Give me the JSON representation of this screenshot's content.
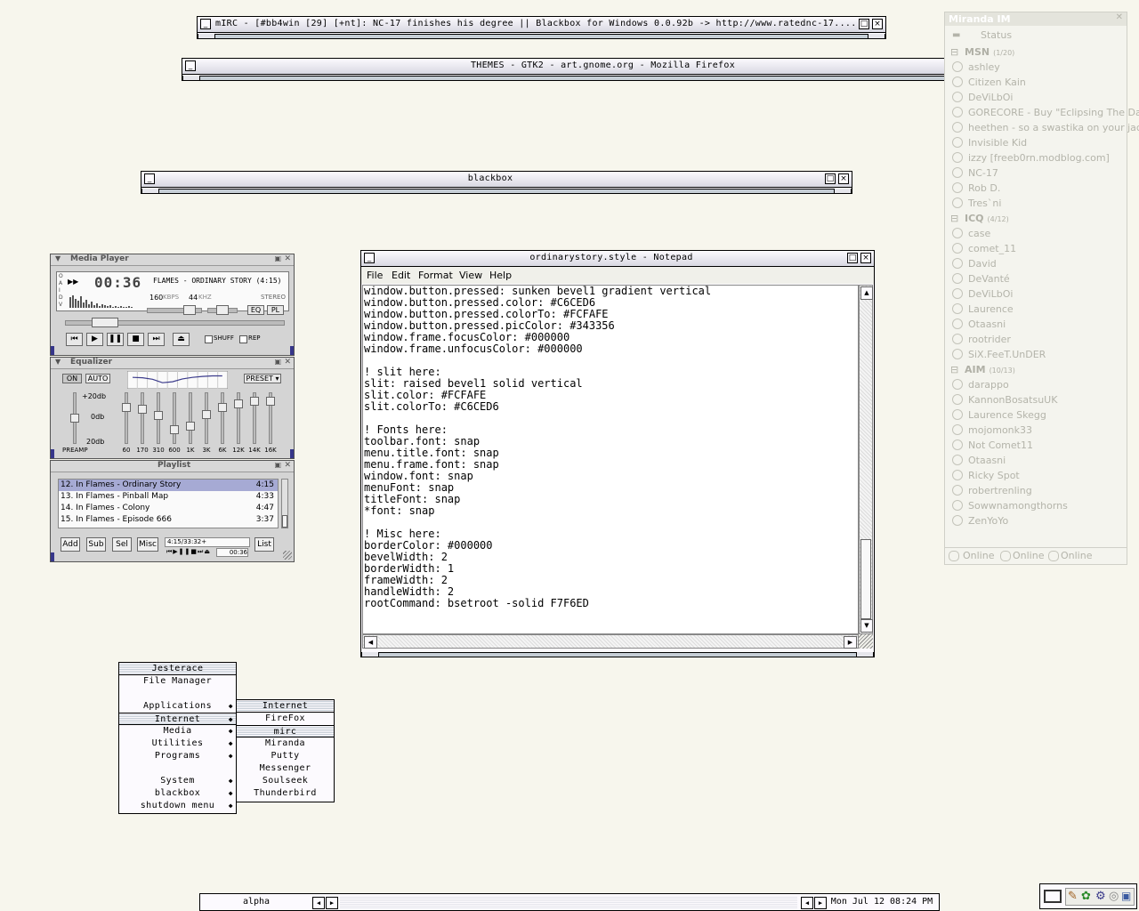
{
  "windows": {
    "mirc": {
      "title": "mIRC - [#bb4win [29] [+nt]: NC-17 finishes his degree || Blackbox for Windows 0.0.92b -> http://www.ratednc-17...."
    },
    "firefox": {
      "title": "THEMES - GTK2 - art.gnome.org - Mozilla Firefox"
    },
    "blackbox": {
      "title": "blackbox"
    }
  },
  "notepad": {
    "title": "ordinarystory.style - Notepad",
    "menu": [
      "File",
      "Edit",
      "Format",
      "View",
      "Help"
    ],
    "lines": [
      "window.button.pressed: sunken bevel1 gradient vertical",
      "window.button.pressed.color: #C6CED6",
      "window.button.pressed.colorTo: #FCFAFE",
      "window.button.pressed.picColor: #343356",
      "window.frame.focusColor: #000000",
      "window.frame.unfocusColor: #000000",
      "",
      "! slit here:",
      "slit: raised bevel1 solid vertical",
      "slit.color: #FCFAFE",
      "slit.colorTo: #C6CED6",
      "",
      "! Fonts here:",
      "toolbar.font: snap",
      "menu.title.font: snap",
      "menu.frame.font: snap",
      "window.font: snap",
      "menuFont: snap",
      "titleFont: snap",
      "*font: snap",
      "",
      "! Misc here:",
      "borderColor: #000000",
      "bevelWidth: 2",
      "borderWidth: 1",
      "frameWidth: 2",
      "handleWidth: 2",
      "rootCommand: bsetroot -solid F7F6ED"
    ]
  },
  "mediaplayer": {
    "title": "Media Player",
    "time": "00:36",
    "track": "FLAMES - ORDINARY STORY (4:15)",
    "kbps": "160",
    "kbps_unit": "KBPS",
    "khz": "44",
    "khz_unit": "KHZ",
    "stereo": "STEREO",
    "eq_btn": "EQ",
    "pl_btn": "PL",
    "shuff": "SHUFF",
    "rep": "REP",
    "seek_fraction": 0.14,
    "volume_fraction": 0.85,
    "balance_fraction": 0.5
  },
  "equalizer": {
    "title": "Equalizer",
    "on": "ON",
    "auto": "AUTO",
    "preset": "PRESET",
    "db_top": "+20db",
    "db_mid": "0db",
    "db_bot": "20db",
    "preamp": "PREAMP",
    "bands": [
      "60",
      "170",
      "310",
      "600",
      "1K",
      "3K",
      "6K",
      "12K",
      "14K",
      "16K"
    ],
    "levels": [
      0.4,
      0.35,
      0.1,
      -0.45,
      -0.3,
      0.15,
      0.4,
      0.55,
      0.65,
      0.65
    ],
    "preamp_level": 0.0
  },
  "playlist": {
    "title": "Playlist",
    "items": [
      {
        "name": "12. In Flames - Ordinary Story",
        "time": "4:15"
      },
      {
        "name": "13. In Flames - Pinball Map",
        "time": "4:33"
      },
      {
        "name": "14. In Flames - Colony",
        "time": "4:47"
      },
      {
        "name": "15. In Flames - Episode 666",
        "time": "3:37"
      }
    ],
    "buttons": [
      "Add",
      "Sub",
      "Sel",
      "Misc"
    ],
    "list_btn": "List",
    "total": "4:15/33:32+",
    "mini_time": "00:36"
  },
  "menu_main": {
    "title": "Jesterace",
    "items": [
      {
        "label": "File Manager",
        "submenu": false
      },
      {
        "label": "",
        "submenu": false
      },
      {
        "label": "Applications",
        "submenu": true
      },
      {
        "label": "Internet",
        "submenu": true
      },
      {
        "label": "Media",
        "submenu": true
      },
      {
        "label": "Utilities",
        "submenu": true
      },
      {
        "label": "Programs",
        "submenu": true
      },
      {
        "label": "",
        "submenu": false
      },
      {
        "label": "System",
        "submenu": true
      },
      {
        "label": "blackbox",
        "submenu": true
      },
      {
        "label": "shutdown menu",
        "submenu": true
      }
    ]
  },
  "menu_internet": {
    "title": "Internet",
    "items": [
      "FireFox",
      "mirc",
      "Miranda",
      "Putty",
      "Messenger",
      "Soulseek",
      "Thunderbird"
    ]
  },
  "miranda": {
    "title": "Miranda IM",
    "status": "Status",
    "msn_group": "MSN",
    "msn_count": "(1/20)",
    "msn": [
      "ashley",
      "Citizen Kain",
      "DeViLbOi",
      "GORECORE - Buy \"Eclipsing The Dawn\"",
      "heethen - so a swastika on your jacket",
      "Invisible Kid",
      "izzy [freeb0rn.modblog.com]",
      "NC-17",
      "Rob D.",
      "Tres`ni"
    ],
    "icq_group": "ICQ",
    "icq_count": "(4/12)",
    "icq": [
      "case",
      "comet_11",
      "David",
      "DeVanté",
      "DeViLbOi",
      "Laurence",
      "Otaasni",
      "rootrider",
      "SiX.FeeT.UnDER"
    ],
    "aim_group": "AIM",
    "aim_count": "(10/13)",
    "aim": [
      "darappo",
      "KannonBosatsuUK",
      "Laurence Skegg",
      "mojomonk33",
      "Not Comet11",
      "Otaasni",
      "Ricky Spot",
      "robertrenling",
      "Sowwnamongthorns",
      "ZenYoYo"
    ],
    "bottom_status": [
      "Online",
      "Online",
      "Online"
    ]
  },
  "toolbar": {
    "workspace": "alpha",
    "clock": "Mon Jul 12 08:24 PM"
  },
  "icons": {
    "min": "minimize-icon",
    "max": "maximize-icon",
    "close": "close-icon"
  }
}
